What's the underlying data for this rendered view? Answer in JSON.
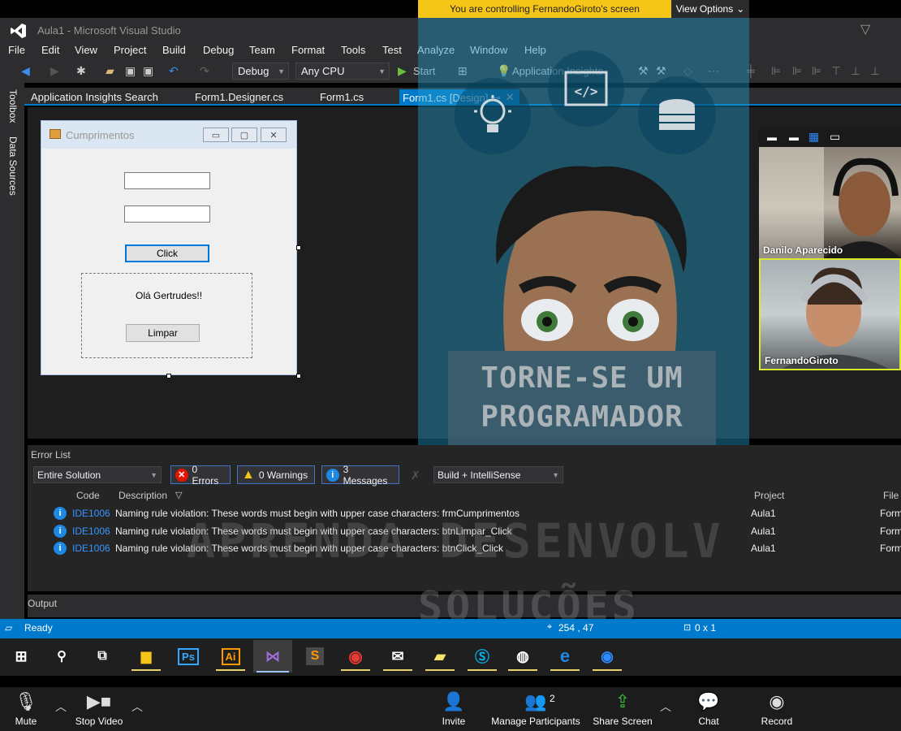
{
  "zoom_banner": {
    "controlling_text": "You are controlling FernandoGiroto's screen",
    "view_options": "View Options"
  },
  "vs": {
    "title": "Aula1 - Microsoft Visual Studio",
    "menu": [
      "File",
      "Edit",
      "View",
      "Project",
      "Build",
      "Debug",
      "Team",
      "Format",
      "Tools",
      "Test",
      "Analyze",
      "Window",
      "Help"
    ],
    "toolbar": {
      "config": "Debug",
      "platform": "Any CPU",
      "start": "Start",
      "insights": "Application Insights"
    },
    "side_tabs": [
      "Toolbox",
      "Data Sources"
    ],
    "doc_tabs": [
      "Application Insights Search",
      "Form1.Designer.cs",
      "Form1.cs",
      "Form1.cs [Design]"
    ]
  },
  "winform": {
    "title": "Cumprimentos",
    "click_label": "Click",
    "greeting": "Olá Gertrudes!!",
    "clear_label": "Limpar"
  },
  "promo": {
    "line1": "TORNE-SE UM",
    "line2": "PROGRAMADOR"
  },
  "participants": [
    {
      "name": "Danilo Aparecido"
    },
    {
      "name": "FernandoGiroto"
    }
  ],
  "error_list": {
    "title": "Error List",
    "scope": "Entire Solution",
    "errors": "0 Errors",
    "warnings": "0 Warnings",
    "messages": "3 Messages",
    "build_filter": "Build + IntelliSense",
    "columns": {
      "code": "Code",
      "description": "Description",
      "project": "Project",
      "file": "File"
    },
    "rows": [
      {
        "code": "IDE1006",
        "description": "Naming rule violation: These words must begin with upper case characters: frmCumprimentos",
        "project": "Aula1",
        "file": "Form"
      },
      {
        "code": "IDE1006",
        "description": "Naming rule violation: These words must begin with upper case characters: btnLimpar_Click",
        "project": "Aula1",
        "file": "Form"
      },
      {
        "code": "IDE1006",
        "description": "Naming rule violation: These words must begin with upper case characters: btnClick_Click",
        "project": "Aula1",
        "file": "Form"
      }
    ]
  },
  "watermark": {
    "line1": "APRENDA DESENVOLV",
    "line2": "SOLUÇÕES"
  },
  "output_label": "Output",
  "status": {
    "ready": "Ready",
    "position": "254 , 47",
    "size": "0 x 1"
  },
  "taskbar_apps": [
    "File Explorer",
    "Photoshop",
    "Illustrator",
    "Visual Studio",
    "Sublime Text",
    "Chrome",
    "Mail",
    "Sticky Notes",
    "Skype",
    "Runner",
    "Edge",
    "Zoom"
  ],
  "zoom_controls": {
    "mute": "Mute",
    "stop_video": "Stop Video",
    "invite": "Invite",
    "manage": "Manage Participants",
    "participant_count": "2",
    "share": "Share Screen",
    "chat": "Chat",
    "record": "Record"
  },
  "colors": {
    "vs_bg": "#2d2d30",
    "vs_accent": "#007acc",
    "zoom_yellow": "#f5c518"
  }
}
